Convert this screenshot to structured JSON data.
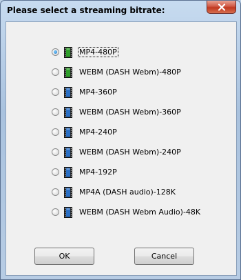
{
  "window": {
    "title": "Please select a streaming bitrate:"
  },
  "options": [
    {
      "label": "MP4-480P",
      "selected": true,
      "icon": "green-film-icon",
      "color": "#2e9e2a"
    },
    {
      "label": "WEBM (DASH Webm)-480P",
      "selected": false,
      "icon": "green-film-icon",
      "color": "#2e9e2a"
    },
    {
      "label": "MP4-360P",
      "selected": false,
      "icon": "blue-film-icon",
      "color": "#2a6fc4"
    },
    {
      "label": "WEBM (DASH Webm)-360P",
      "selected": false,
      "icon": "blue-film-icon",
      "color": "#2a6fc4"
    },
    {
      "label": "MP4-240P",
      "selected": false,
      "icon": "blue-film-icon",
      "color": "#2a6fc4"
    },
    {
      "label": "WEBM (DASH Webm)-240P",
      "selected": false,
      "icon": "blue-film-icon",
      "color": "#2a6fc4"
    },
    {
      "label": "MP4-192P",
      "selected": false,
      "icon": "blue-film-icon",
      "color": "#2a6fc4"
    },
    {
      "label": "MP4A (DASH audio)-128K",
      "selected": false,
      "icon": "blue-film-icon",
      "color": "#2a6fc4"
    },
    {
      "label": "WEBM (DASH Webm Audio)-48K",
      "selected": false,
      "icon": "blue-film-icon",
      "color": "#2a6fc4"
    }
  ],
  "buttons": {
    "ok_label": "OK",
    "cancel_label": "Cancel"
  }
}
